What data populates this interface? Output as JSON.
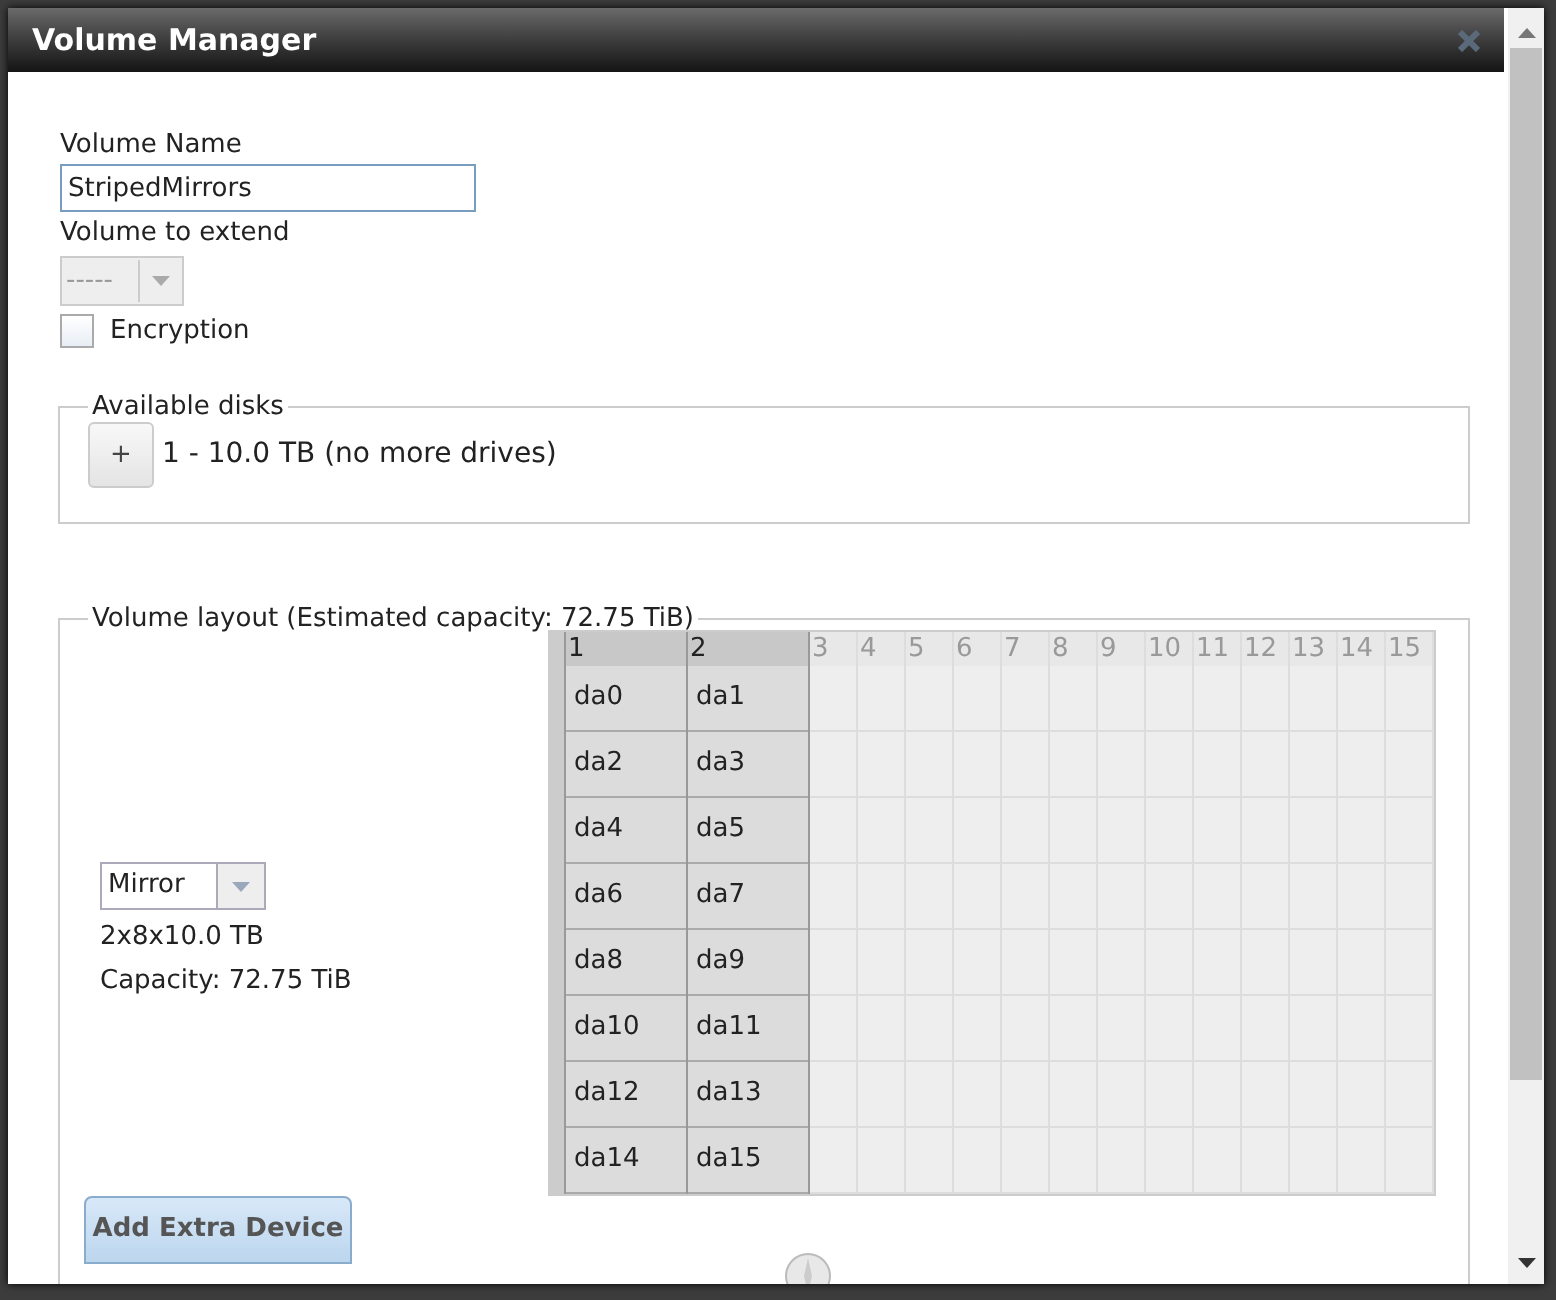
{
  "window": {
    "title": "Volume Manager"
  },
  "volume_name": {
    "label": "Volume Name",
    "value": "StripedMirrors"
  },
  "volume_to_extend": {
    "label": "Volume to extend",
    "value": "-----",
    "disabled": true
  },
  "encryption": {
    "label": "Encryption",
    "checked": false
  },
  "available_disks": {
    "legend": "Available disks",
    "add_label": "+",
    "text": "1 - 10.0 TB (no more drives)"
  },
  "volume_layout": {
    "legend": "Volume layout (Estimated capacity: 72.75 TiB)",
    "layout_type": "Mirror",
    "summary": "2x8x10.0 TB",
    "capacity": "Capacity: 72.75 TiB",
    "columns": [
      {
        "label": "1",
        "selected": true
      },
      {
        "label": "2",
        "selected": true
      },
      {
        "label": "3",
        "selected": false
      },
      {
        "label": "4",
        "selected": false
      },
      {
        "label": "5",
        "selected": false
      },
      {
        "label": "6",
        "selected": false
      },
      {
        "label": "7",
        "selected": false
      },
      {
        "label": "8",
        "selected": false
      },
      {
        "label": "9",
        "selected": false
      },
      {
        "label": "10",
        "selected": false
      },
      {
        "label": "11",
        "selected": false
      },
      {
        "label": "12",
        "selected": false
      },
      {
        "label": "13",
        "selected": false
      },
      {
        "label": "14",
        "selected": false
      },
      {
        "label": "15",
        "selected": false
      }
    ],
    "rows": [
      [
        "da0",
        "da1"
      ],
      [
        "da2",
        "da3"
      ],
      [
        "da4",
        "da5"
      ],
      [
        "da6",
        "da7"
      ],
      [
        "da8",
        "da9"
      ],
      [
        "da10",
        "da11"
      ],
      [
        "da12",
        "da13"
      ],
      [
        "da14",
        "da15"
      ]
    ]
  },
  "buttons": [
    "Add Extra Device"
  ]
}
